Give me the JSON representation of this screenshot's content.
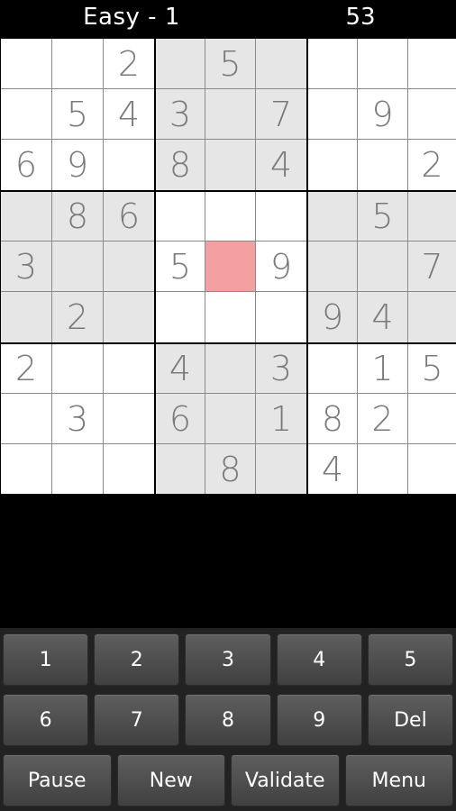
{
  "header": {
    "title": "Easy - 1",
    "timer": "53"
  },
  "board": {
    "selected": [
      4,
      4
    ],
    "colors": {
      "given_digit": "#7a7a7a",
      "shaded": "#e6e6e6",
      "white": "#ffffff",
      "selected": "#f4a0a0"
    },
    "rows": [
      [
        "",
        "",
        "2",
        "",
        "5",
        "",
        "",
        "",
        ""
      ],
      [
        "",
        "5",
        "4",
        "3",
        "",
        "7",
        "",
        "9",
        ""
      ],
      [
        "6",
        "9",
        "",
        "8",
        "",
        "4",
        "",
        "",
        "2"
      ],
      [
        "",
        "8",
        "6",
        "",
        "",
        "",
        "",
        "5",
        ""
      ],
      [
        "3",
        "",
        "",
        "5",
        "",
        "9",
        "",
        "",
        "7"
      ],
      [
        "",
        "2",
        "",
        "",
        "",
        "",
        "9",
        "4",
        ""
      ],
      [
        "2",
        "",
        "",
        "4",
        "",
        "3",
        "",
        "1",
        "5"
      ],
      [
        "",
        "3",
        "",
        "6",
        "",
        "1",
        "8",
        "2",
        ""
      ],
      [
        "",
        "",
        "",
        "",
        "8",
        "",
        "4",
        "",
        ""
      ]
    ]
  },
  "keypad": {
    "row1": [
      "1",
      "2",
      "3",
      "4",
      "5"
    ],
    "row2": [
      "6",
      "7",
      "8",
      "9",
      "Del"
    ],
    "row3": [
      "Pause",
      "New",
      "Validate",
      "Menu"
    ]
  }
}
